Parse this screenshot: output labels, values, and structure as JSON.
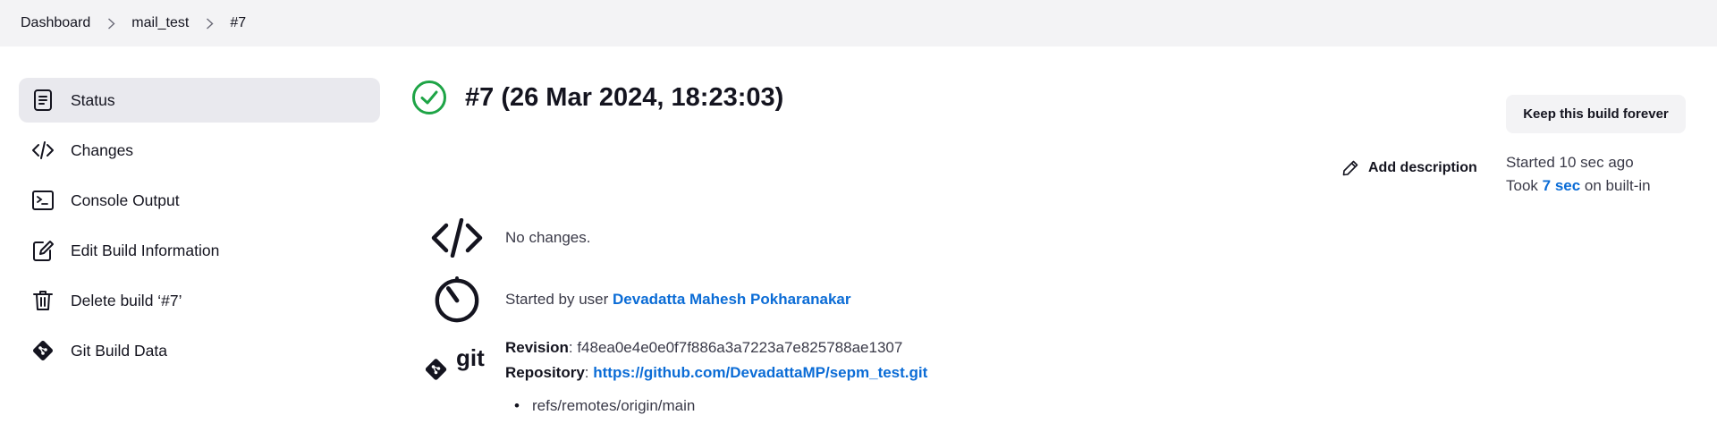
{
  "breadcrumb": {
    "items": [
      "Dashboard",
      "mail_test",
      "#7"
    ]
  },
  "sidebar": {
    "items": [
      {
        "label": "Status",
        "icon": "document-icon",
        "active": true
      },
      {
        "label": "Changes",
        "icon": "code-icon"
      },
      {
        "label": "Console Output",
        "icon": "terminal-icon"
      },
      {
        "label": "Edit Build Information",
        "icon": "edit-icon"
      },
      {
        "label": "Delete build ‘#7’",
        "icon": "trash-icon"
      },
      {
        "label": "Git Build Data",
        "icon": "git-icon"
      }
    ]
  },
  "build": {
    "title": "#7 (26 Mar 2024, 18:23:03)",
    "status_icon": "success-check-icon",
    "status_color": "#1ea446"
  },
  "actions": {
    "keep_forever": "Keep this build forever",
    "add_description": "Add description"
  },
  "timing": {
    "started": "Started 10 sec ago",
    "took_prefix": "Took ",
    "took_value": "7 sec",
    "took_suffix": " on built-in"
  },
  "changes": {
    "text": "No changes."
  },
  "cause": {
    "prefix": "Started by user ",
    "user": "Devadatta Mahesh Pokharanakar"
  },
  "git": {
    "revision_label": "Revision",
    "revision_value": "f48ea0e4e0e0f7f886a3a7223a7e825788ae1307",
    "repository_label": "Repository",
    "repository_value": "https://github.com/DevadattaMP/sepm_test.git",
    "branches": [
      "refs/remotes/origin/main"
    ],
    "logo_text": "git"
  },
  "colors": {
    "link": "#0b6cd6",
    "breadcrumb_bg": "#f3f3f5",
    "active_bg": "#e9e9ee"
  }
}
